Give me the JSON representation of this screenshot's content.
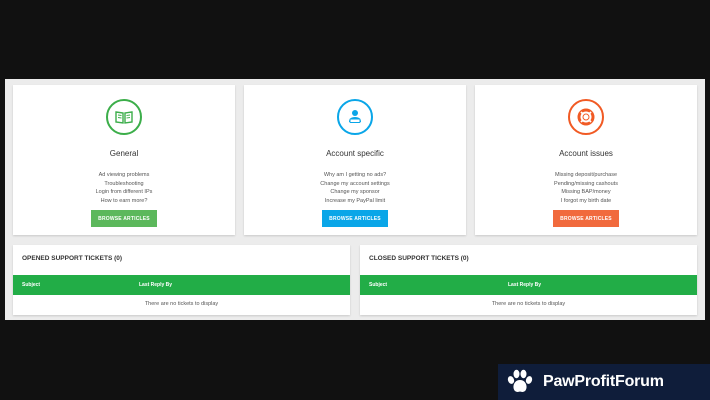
{
  "topics": [
    {
      "title": "General",
      "icon": "book-icon",
      "color": "#3cae4a",
      "lines": [
        "Ad viewing problems",
        "Troubleshooting",
        "Login from different IPs",
        "How to earn more?"
      ],
      "button": "BROWSE ARTICLES",
      "button_color": "#5cb85c"
    },
    {
      "title": "Account specific",
      "icon": "user-icon",
      "color": "#0aa6e8",
      "lines": [
        "Why am I getting no ads?",
        "Change my account settings",
        "Change my sponsor",
        "Increase my PayPal limit"
      ],
      "button": "BROWSE ARTICLES",
      "button_color": "#0aa6e8"
    },
    {
      "title": "Account issues",
      "icon": "lifebuoy-icon",
      "color": "#f15a24",
      "lines": [
        "Missing deposit/purchase",
        "Pending/missing cashouts",
        "Missing BAP/money",
        "I forgot my birth date"
      ],
      "button": "BROWSE ARTICLES",
      "button_color": "#f16a3d"
    }
  ],
  "opened": {
    "title": "OPENED SUPPORT TICKETS (0)",
    "col_subject": "Subject",
    "col_last_reply": "Last Reply By",
    "empty": "There are no tickets to display"
  },
  "closed": {
    "title": "CLOSED SUPPORT TICKETS (0)",
    "col_subject": "Subject",
    "col_last_reply": "Last Reply By",
    "empty": "There are no tickets to display"
  },
  "watermark": {
    "text": "PawProfitForum",
    "icon": "paw-icon"
  },
  "colors": {
    "header_green": "#22ad47",
    "watermark_bg": "#0f1d3a"
  }
}
